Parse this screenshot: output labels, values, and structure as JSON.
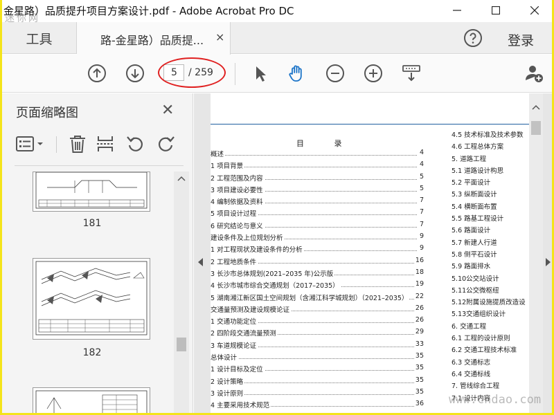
{
  "window": {
    "title": "金星路）品质提升项目方案设计.pdf - Adobe Acrobat Pro DC",
    "watermark_top": "迷你网",
    "watermark_bottom": "www.cndao.com"
  },
  "tabs": {
    "tools": "工具",
    "document": "路-金星路）品质提...",
    "close": "×",
    "login": "登录"
  },
  "toolbar": {
    "current_page": "5",
    "total_pages": "/ 259"
  },
  "thumbnails_panel": {
    "title": "页面缩略图",
    "close": "✕",
    "thumbnails": [
      {
        "label": "181"
      },
      {
        "label": "182"
      }
    ]
  },
  "document": {
    "toc_title": "目  录",
    "toc_left": [
      {
        "text": "概述",
        "page": "4"
      },
      {
        "text": "1 项目背景",
        "page": "4"
      },
      {
        "text": "2 工程范围及内容",
        "page": "5"
      },
      {
        "text": "3 项目建设必要性",
        "page": "5"
      },
      {
        "text": "4 编制依据及资料",
        "page": "7"
      },
      {
        "text": "5 项目设计过程",
        "page": "7"
      },
      {
        "text": "6 研究结论与意义",
        "page": "7"
      },
      {
        "text": "建设条件及上位规划分析",
        "page": "9"
      },
      {
        "text": "1 对工程现状及建设条件的分析",
        "page": "9"
      },
      {
        "text": "2 工程地质条件",
        "page": "16"
      },
      {
        "text": "3 长沙市总体规划(2021–2035 年)公示版",
        "page": "18"
      },
      {
        "text": "4 长沙市城市综合交通规划（2017–2035）",
        "page": "19"
      },
      {
        "text": "5 湖南湘江新区国土空间规划（含湘江科学城规划）（2021–2035）",
        "page": "22"
      },
      {
        "text": "交通量预测及建设规模论证",
        "page": "26"
      },
      {
        "text": "1 交通功能定位",
        "page": "26"
      },
      {
        "text": "2 四阶段交通流量预测",
        "page": "29"
      },
      {
        "text": "3 车道规模论证",
        "page": "33"
      },
      {
        "text": "总体设计",
        "page": "35"
      },
      {
        "text": "1 设计目标及定位",
        "page": "35"
      },
      {
        "text": "2 设计策略",
        "page": "35"
      },
      {
        "text": "3 设计原则",
        "page": "35"
      },
      {
        "text": "4 主要采用技术规范",
        "page": "36"
      }
    ],
    "toc_right": [
      "4.5 技术标准及技术参数",
      "4.6 工程总体方案",
      "5.  道路工程",
      "5.1 道路设计构思",
      "5.2 平面设计",
      "5.3 纵断面设计",
      "5.4 横断面布置",
      "5.5 路基工程设计",
      "5.6 路面设计",
      "5.7 新建人行道",
      "5.8 侧平石设计",
      "5.9 路面排水",
      "5.10公交站设计",
      "5.11公交微枢纽",
      "5.12附属设施提质改造设",
      "5.13交通组织设计",
      "6.  交通工程",
      "6.1 工程的设计原则",
      "6.2 交通工程技术标准",
      "6.3 交通标志",
      "6.4 交通标线",
      "7.  管线综合工程",
      "7.1 设计内容"
    ]
  },
  "colors": {
    "background_frame": "#f4e41a",
    "accent_blue": "#1a73c8",
    "annotation_red": "#e02020"
  }
}
